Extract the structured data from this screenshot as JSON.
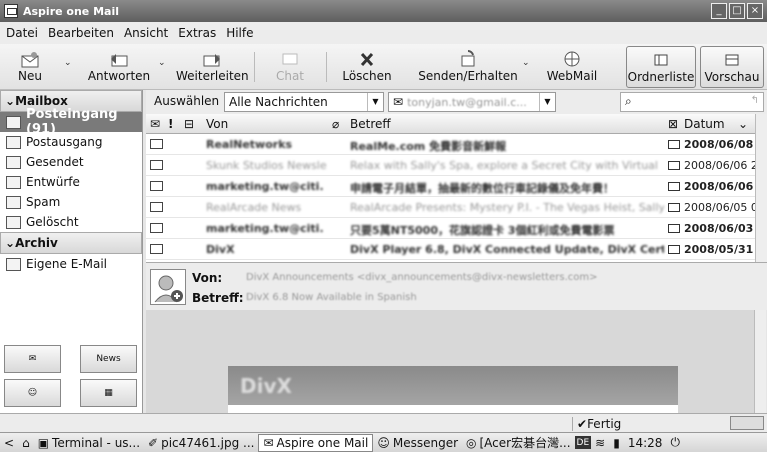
{
  "window": {
    "title": "Aspire one Mail"
  },
  "menu": [
    "Datei",
    "Bearbeiten",
    "Ansicht",
    "Extras",
    "Hilfe"
  ],
  "toolbar": {
    "new": "Neu",
    "reply": "Antworten",
    "forward": "Weiterleiten",
    "chat": "Chat",
    "delete": "Löschen",
    "sendrecv": "Senden/Erhalten",
    "webmail": "WebMail",
    "folderlist": "Ordnerliste",
    "preview": "Vorschau"
  },
  "sidebar": {
    "mailbox": "Mailbox",
    "inbox": "Posteingang (91)",
    "outbox": "Postausgang",
    "sent": "Gesendet",
    "drafts": "Entwürfe",
    "spam": "Spam",
    "deleted": "Gelöscht",
    "archive": "Archiv",
    "own": "Eigene E-Mail",
    "news_label": "News"
  },
  "filter": {
    "label": "Auswählen",
    "value": "Alle Nachrichten",
    "account": "tonyjan.tw@gmail.c..."
  },
  "list": {
    "col_from": "Von",
    "col_subject": "Betreff",
    "col_date": "Datum",
    "rows": [
      {
        "from": "RealNetworks",
        "subject": "RealMe.com 免費影音新鮮報",
        "date": "2008/06/08",
        "bold": true,
        "opened": false
      },
      {
        "from": "Skunk Studios Newsle",
        "subject": "Relax with Sally's Spa, explore a Secret City with Virtual",
        "date": "2008/06/06 2",
        "bold": false,
        "opened": true
      },
      {
        "from": "marketing.tw@citi.",
        "subject": "申請電子月結單，抽最新的數位行車記錄儀及免年費！",
        "date": "2008/06/06",
        "bold": true,
        "opened": false
      },
      {
        "from": "RealArcade News",
        "subject": "RealArcade Presents: Mystery P.I. - The Vegas Heist, Sally",
        "date": "2008/06/05 0",
        "bold": false,
        "opened": true
      },
      {
        "from": "marketing.tw@citi.",
        "subject": "只要5萬NT5000，花旗認證卡 3個紅利或免費電影票",
        "date": "2008/06/03",
        "bold": true,
        "opened": false
      },
      {
        "from": "DivX",
        "subject": "DivX Player 6.8, DivX Connected Update, DivX Certi",
        "date": "2008/05/31",
        "bold": true,
        "opened": false
      }
    ]
  },
  "preview": {
    "from_label": "Von:",
    "from_value": "DivX Announcements <divx_announcements@divx-newsletters.com>",
    "subject_label": "Betreff:",
    "subject_value": "DivX 6.8 Now Available in Spanish",
    "banner": "DivX"
  },
  "status": {
    "text": "Fertig"
  },
  "taskbar": {
    "items": [
      "Terminal - us...",
      "pic47461.jpg ...",
      "Aspire one Mail",
      "Messenger",
      "[Acer宏碁台灣..."
    ],
    "tray": "DE",
    "clock": "14:28"
  }
}
